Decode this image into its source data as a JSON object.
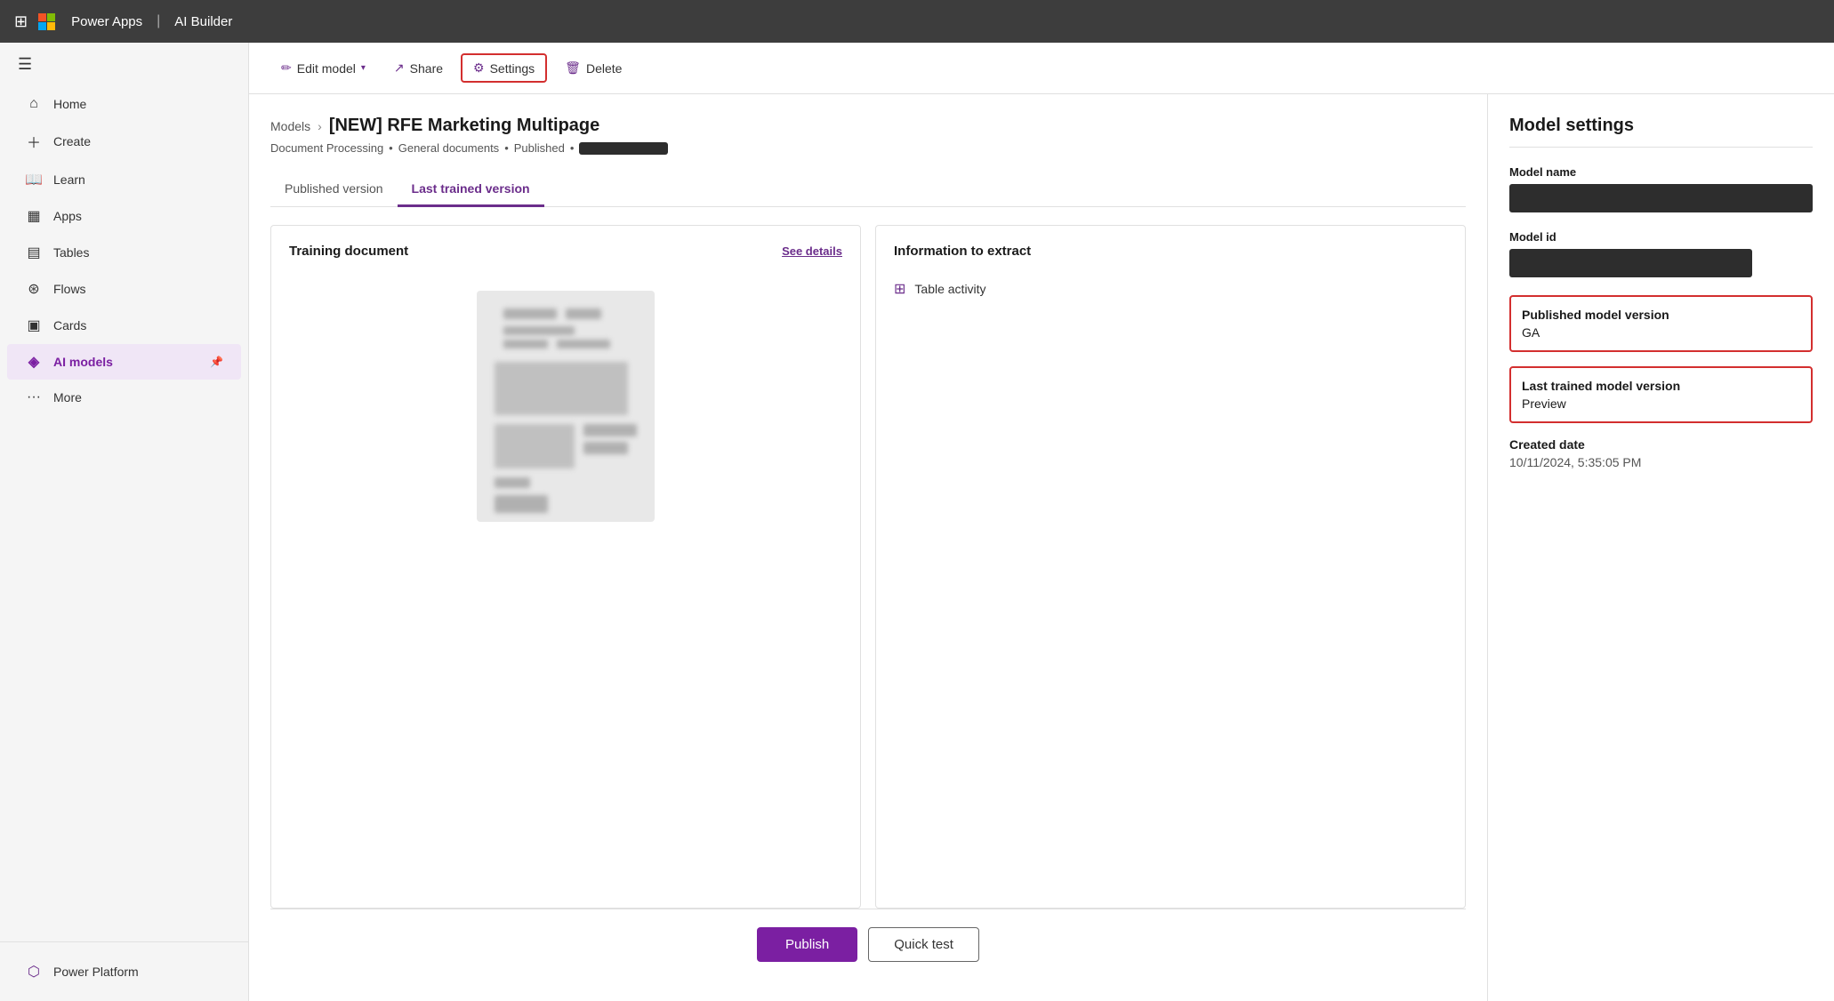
{
  "topbar": {
    "app_name": "Power Apps",
    "separator": "|",
    "section": "AI Builder"
  },
  "sidebar": {
    "items": [
      {
        "id": "home",
        "label": "Home",
        "icon": "⌂"
      },
      {
        "id": "create",
        "label": "Create",
        "icon": "+"
      },
      {
        "id": "learn",
        "label": "Learn",
        "icon": "📖"
      },
      {
        "id": "apps",
        "label": "Apps",
        "icon": "⊞"
      },
      {
        "id": "tables",
        "label": "Tables",
        "icon": "⊟"
      },
      {
        "id": "flows",
        "label": "Flows",
        "icon": "⊘"
      },
      {
        "id": "cards",
        "label": "Cards",
        "icon": "⊡"
      },
      {
        "id": "ai-models",
        "label": "AI models",
        "icon": "$",
        "active": true
      },
      {
        "id": "more",
        "label": "More",
        "icon": "···"
      }
    ],
    "bottom_item": {
      "label": "Power Platform",
      "icon": "⬡"
    }
  },
  "toolbar": {
    "edit_model_label": "Edit model",
    "share_label": "Share",
    "settings_label": "Settings",
    "delete_label": "Delete"
  },
  "breadcrumb": {
    "parent": "Models",
    "current": "[NEW] RFE Marketing Multipage"
  },
  "subtitle": {
    "type": "Document Processing",
    "subtype": "General documents",
    "status": "Published"
  },
  "tabs": [
    {
      "id": "published",
      "label": "Published version",
      "active": false
    },
    {
      "id": "last-trained",
      "label": "Last trained version",
      "active": true
    }
  ],
  "training_card": {
    "title": "Training document",
    "link_label": "See details"
  },
  "extract_card": {
    "title": "Information to extract",
    "items": [
      {
        "icon": "table",
        "label": "Table activity"
      }
    ]
  },
  "actions": {
    "publish_label": "Publish",
    "quick_test_label": "Quick test"
  },
  "settings_panel": {
    "title": "Model settings",
    "model_name_label": "Model name",
    "model_id_label": "Model id",
    "published_version_label": "Published model version",
    "published_version_value": "GA",
    "last_trained_version_label": "Last trained model version",
    "last_trained_version_value": "Preview",
    "created_date_label": "Created date",
    "created_date_value": "10/11/2024, 5:35:05 PM"
  }
}
